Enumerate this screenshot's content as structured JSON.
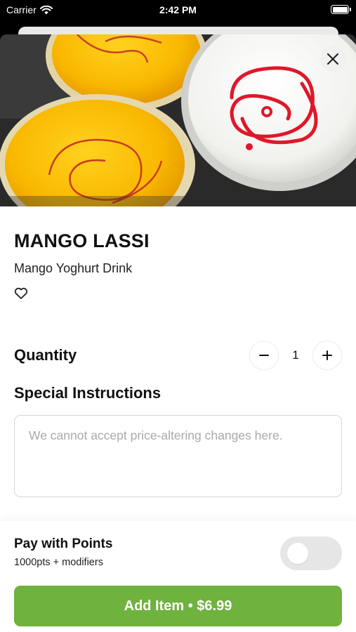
{
  "status_bar": {
    "carrier": "Carrier",
    "time": "2:42 PM"
  },
  "item": {
    "name": "MANGO LASSI",
    "description": "Mango Yoghurt Drink",
    "hero_image": "mango-and-plain-lassi-glasses-with-saffron-drizzle"
  },
  "quantity": {
    "label": "Quantity",
    "value": "1"
  },
  "instructions": {
    "label": "Special Instructions",
    "placeholder": "We cannot accept price-altering changes here."
  },
  "points": {
    "label": "Pay with Points",
    "detail": "1000pts + modifiers",
    "enabled": false
  },
  "add_button": {
    "label": "Add Item • $6.99"
  },
  "colors": {
    "accent_green": "#6fb23e",
    "toggle_off": "#e6e6e6",
    "text": "#111111"
  }
}
